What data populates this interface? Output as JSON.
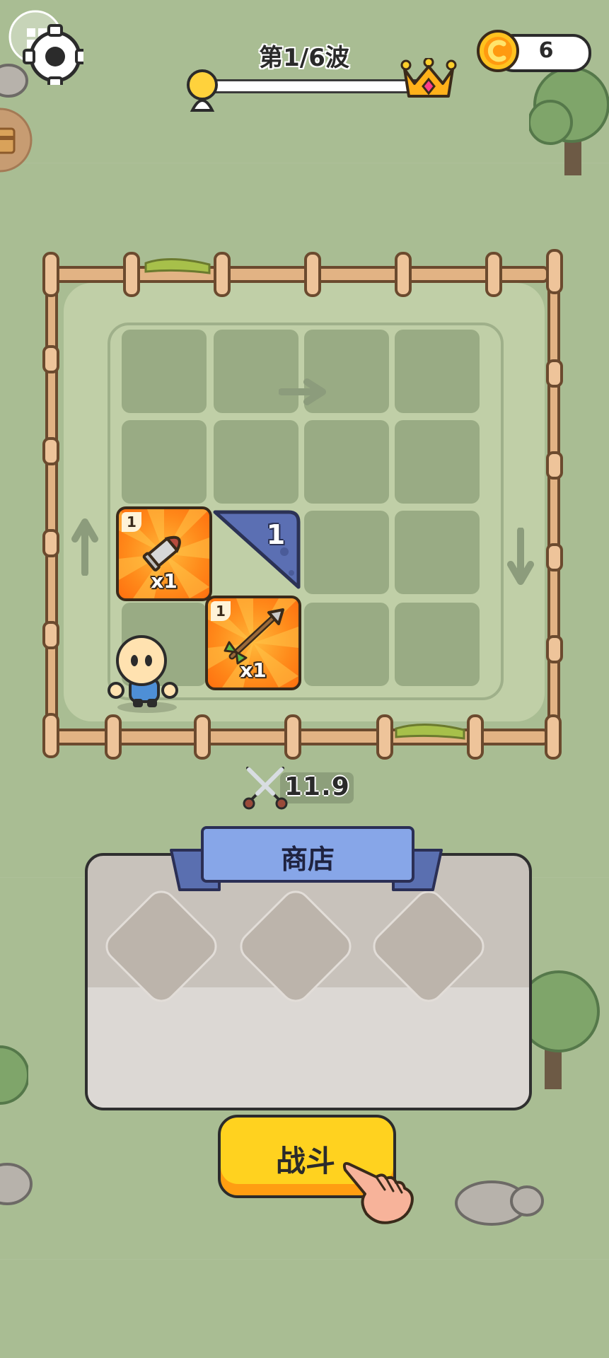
{
  "hud": {
    "wave_label": "第1/6波",
    "wave_progress": 0.0,
    "coins": "6"
  },
  "board": {
    "items": [
      {
        "name": "bullet",
        "level": "1",
        "quantity": "x1"
      },
      {
        "name": "arrow",
        "level": "1",
        "quantity": "x1"
      }
    ],
    "expansion_slot_number": "1"
  },
  "power": "11.9",
  "shop": {
    "title": "商店",
    "slots": [
      {},
      {},
      {}
    ]
  },
  "fight_button": "战斗",
  "icons": [
    "gear-icon",
    "crown-icon",
    "coin-icon",
    "chest-icon",
    "swords-icon",
    "pointing-hand-icon"
  ],
  "colors": {
    "background": "#a9bd93",
    "item_card": "#ff8a1a",
    "fight_button": "#ffd21f",
    "shop_title": "#87a6e8",
    "coin": "#ffb400"
  }
}
